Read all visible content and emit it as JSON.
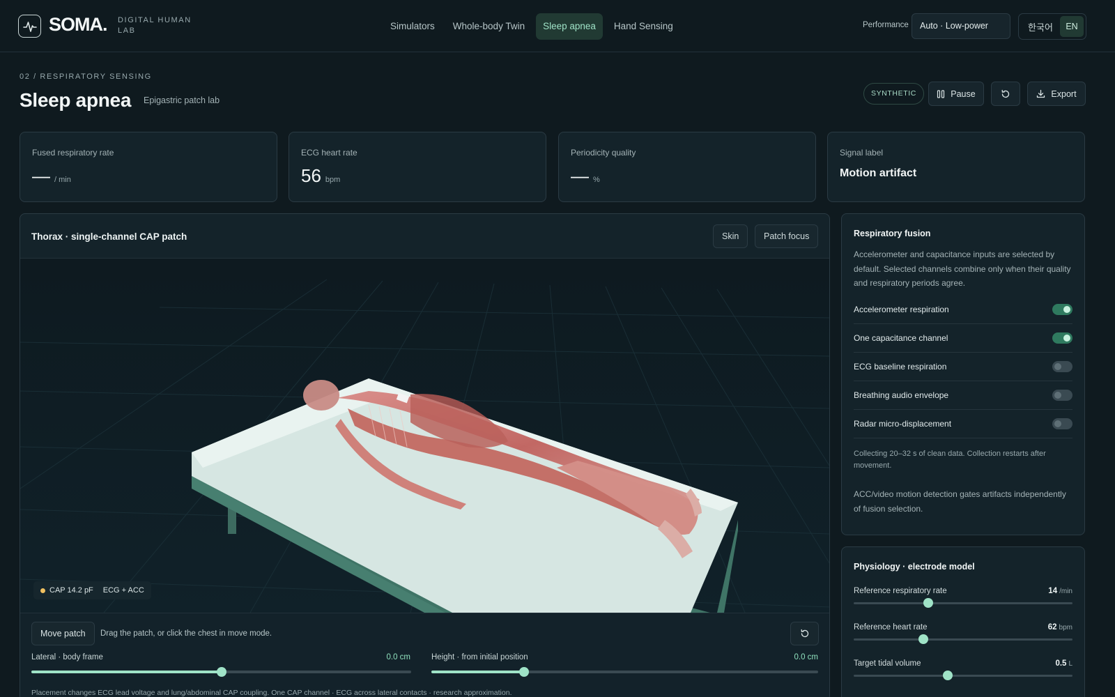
{
  "header": {
    "logo_text": "SOMA.",
    "logo_sub": "DIGITAL HUMAN LAB",
    "nav": [
      {
        "label": "Simulators"
      },
      {
        "label": "Whole-body Twin"
      },
      {
        "label": "Sleep apnea"
      },
      {
        "label": "Hand Sensing"
      }
    ],
    "active_nav": "Sleep apnea",
    "performance_label": "Performance",
    "performance_value": "Auto · Low-power",
    "lang_ko": "한국어",
    "lang_en": "EN"
  },
  "page": {
    "eyebrow": "02 / RESPIRATORY SENSING",
    "title": "Sleep apnea",
    "subtitle": "Epigastric patch lab",
    "badge": "SYNTHETIC",
    "pause_label": "Pause",
    "export_label": "Export"
  },
  "stats": [
    {
      "label": "Fused respiratory rate",
      "value": "—",
      "unit": "/ min"
    },
    {
      "label": "ECG heart rate",
      "value": "56",
      "unit": "bpm"
    },
    {
      "label": "Periodicity quality",
      "value": "—",
      "unit": "%"
    },
    {
      "label": "Signal label",
      "text": "Motion artifact"
    }
  ],
  "viewer": {
    "title": "Thorax · single-channel CAP patch",
    "skin_label": "Skin",
    "patch_focus_label": "Patch focus",
    "tag_cap": "CAP 14.2 pF",
    "tag_mode": "ECG + ACC",
    "move_label": "Move patch",
    "move_hint": "Drag the patch, or click the chest in move mode.",
    "lateral_label": "Lateral · body frame",
    "lateral_value": "0.0 cm",
    "lateral_fraction": 0.5,
    "height_label": "Height · from initial position",
    "height_value": "0.0 cm",
    "height_fraction": 0.24,
    "footnote": "Placement changes ECG lead voltage and lung/abdominal CAP coupling. One CAP channel · ECG across lateral contacts · research approximation."
  },
  "fusion": {
    "title": "Respiratory fusion",
    "description": "Accelerometer and capacitance inputs are selected by default. Selected channels combine only when their quality and respiratory periods agree.",
    "toggles": [
      {
        "label": "Accelerometer respiration",
        "on": true
      },
      {
        "label": "One capacitance channel",
        "on": true
      },
      {
        "label": "ECG baseline respiration",
        "on": false
      },
      {
        "label": "Breathing audio envelope",
        "on": false
      },
      {
        "label": "Radar micro-displacement",
        "on": false
      }
    ],
    "collect_note": "Collecting 20–32 s of clean data. Collection restarts after movement.",
    "motion_note": "ACC/video motion detection gates artifacts independently of fusion selection."
  },
  "physiology": {
    "title": "Physiology · electrode model",
    "rows": [
      {
        "label": "Reference respiratory rate",
        "value": "14",
        "unit": "/min",
        "fraction": 0.34
      },
      {
        "label": "Reference heart rate",
        "value": "62",
        "unit": "bpm",
        "fraction": 0.32
      },
      {
        "label": "Target tidal volume",
        "value": "0.5",
        "unit": "L",
        "fraction": 0.43
      }
    ]
  },
  "colors": {
    "accent": "#9fe3c7",
    "background": "#0f1a1f",
    "panel": "#14232a",
    "status_dot": "#f0c060"
  }
}
